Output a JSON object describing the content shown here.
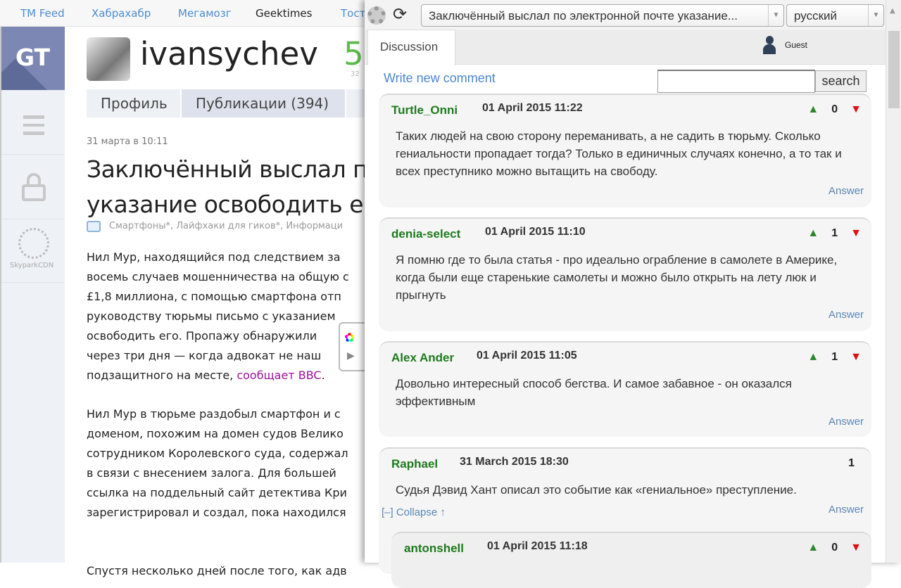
{
  "topnav": [
    "TM Feed",
    "Хабрахабр",
    "Мегамозг",
    "Geektimes",
    "Тостер"
  ],
  "sidebar": {
    "logo": "GT",
    "cdn": "SkyparkCDN"
  },
  "profile": {
    "username": "ivansychev",
    "karma": "5",
    "karma_sub": "32"
  },
  "tabs": [
    "Профиль",
    "Публикации (394)"
  ],
  "article": {
    "date": "31 марта в 10:11",
    "title_lines": [
      "Заключённый выслал по",
      "указание освободить его"
    ],
    "hubs": "Смартфоны*, Лайфхаки для гиков*, Информаци",
    "p1": [
      "Нил Мур, находящийся под следствием за",
      "восемь случаев мошенничества на общую с",
      "£1,8 миллиона, с помощью смартфона отп",
      "руководству тюрьмы письмо с указанием",
      "освободить его. Пропажу обнаружили",
      "через три дня — когда адвокат не наш"
    ],
    "p1_last": "подзащитного на месте, ",
    "p1_link": "сообщает BBC",
    "p1_end": ".",
    "p2": [
      "Нил Мур в тюрьме раздобыл смартфон и с",
      "доменом, похожим на домен судов Велико",
      "сотрудником Королевского суда, содержал",
      "в связи с внесением залога. Для большей",
      "ссылка на поддельный сайт детектива Кри",
      "зарегистрировал и создал, пока находился"
    ],
    "p3": "Спустя несколько дней после того, как адв"
  },
  "panel": {
    "page_select": "Заключённый выслал по электронной почте указание...",
    "language_select": "русский",
    "tab": "Discussion",
    "user": "Guest",
    "write_comment": "Write new comment",
    "search_value": "",
    "search_button": "search",
    "answer_label": "Answer",
    "collapse_label": "[–] Collapse ↑",
    "comments": [
      {
        "author": "Turtle_Onni",
        "date": "01 April 2015 11:22",
        "score": "0",
        "text": "Таких людей на свою сторону переманивать, а не садить в тюрьму. Сколько гениальности пропадает тогда? Только в единичных случаях конечно, а то так и всех преступнико можно вытащить на свободу."
      },
      {
        "author": "denia-select",
        "date": "01 April 2015 11:10",
        "score": "1",
        "text": "Я помню где то была статья - про идеально ограбление в самолете в Америке, когда были еще старенькие самолеты и можно было открыть на лету люк и прыгнуть"
      },
      {
        "author": "Alex Ander",
        "date": "01 April 2015 11:05",
        "score": "1",
        "text": "Довольно интересный способ бегства. И самое забавное - он оказался эффективным"
      },
      {
        "author": "Raphael",
        "date": "31 March 2015 18:30",
        "score": "1",
        "text": "Судья Дэвид Хант описал это событие как «гениальное» преступление."
      },
      {
        "author": "antonshell",
        "date": "01 April 2015 11:18",
        "score": "0",
        "text": ""
      }
    ]
  },
  "colors": {
    "author": "#1d7a1d",
    "link": "#4a86cc",
    "upvote": "#2a8a2a",
    "downvote": "#e01010",
    "logo": "#7c87b3"
  }
}
